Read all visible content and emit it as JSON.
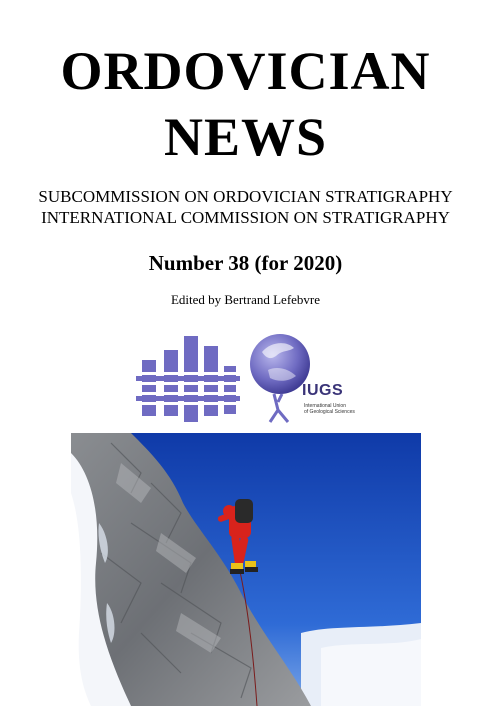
{
  "header": {
    "title_line1": "ORDOVICIAN",
    "title_line2": "NEWS"
  },
  "subtitle": {
    "line1": "SUBCOMMISSION ON ORDOVICIAN STRATIGRAPHY",
    "line2": "INTERNATIONAL COMMISSION ON STRATIGRAPHY"
  },
  "issue": {
    "number": "Number 38 (for 2020)",
    "editor": "Edited by Bertrand Lefebvre"
  },
  "logos": {
    "left_icon": "sos-columns-logo",
    "right_icon": "iugs-globe-logo",
    "iugs_abbr": "IUGS",
    "iugs_sub_line1": "International Union",
    "iugs_sub_line2": "of Geological Sciences",
    "color": "#6f6bc2"
  },
  "cover_photo": {
    "icon": "climber-on-rock-ridge-photo",
    "sky_color": "#1b4fc0",
    "suit_color": "#d8231c"
  }
}
